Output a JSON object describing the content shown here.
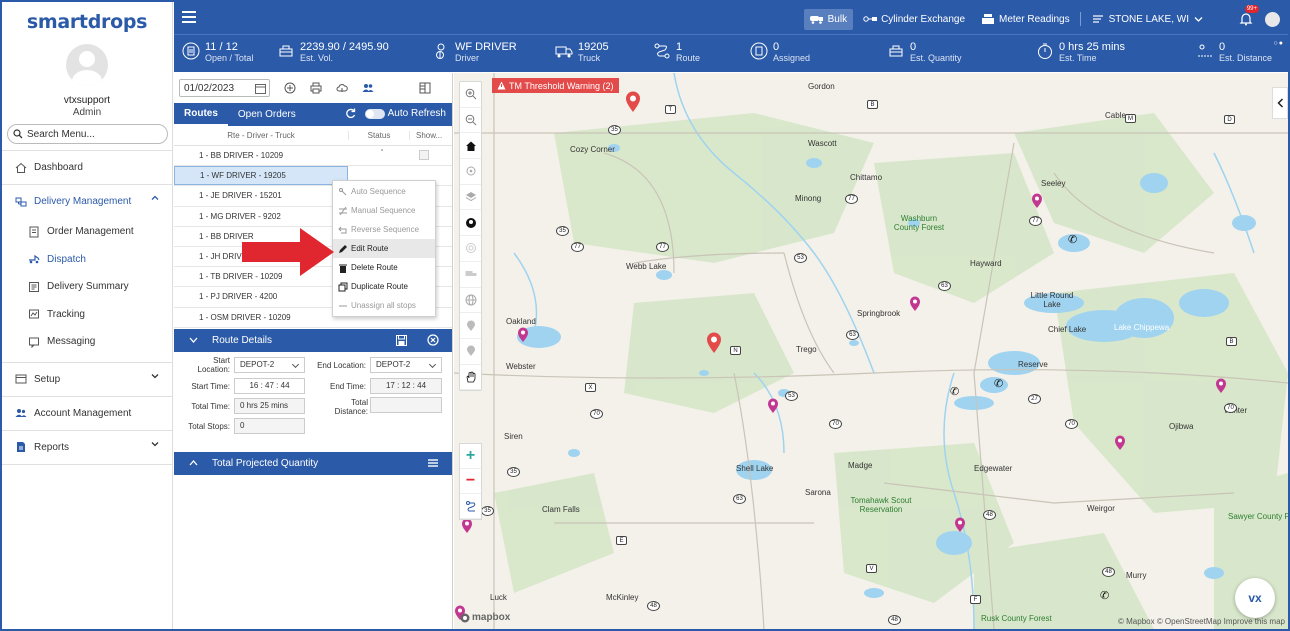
{
  "brand": {
    "logo": "smartdrops"
  },
  "user": {
    "name": "vtxsupport",
    "role": "Admin"
  },
  "search": {
    "placeholder": "Search Menu..."
  },
  "nav": {
    "dashboard": "Dashboard",
    "delivery_management": "Delivery Management",
    "order_management": "Order Management",
    "dispatch": "Dispatch",
    "delivery_summary": "Delivery Summary",
    "tracking": "Tracking",
    "messaging": "Messaging",
    "setup": "Setup",
    "account_management": "Account Management",
    "reports": "Reports"
  },
  "topbar": {
    "bulk": "Bulk",
    "cylinder_exchange": "Cylinder Exchange",
    "meter_readings": "Meter Readings",
    "location": "STONE LAKE, WI",
    "notif_badge": "99+"
  },
  "stats": [
    {
      "value": "11 / 12",
      "label": "Open / Total"
    },
    {
      "value": "2239.90 / 2495.90",
      "label": "Est. Vol."
    },
    {
      "value": "WF DRIVER",
      "label": "Driver"
    },
    {
      "value": "19205",
      "label": "Truck"
    },
    {
      "value": "1",
      "label": "Route"
    },
    {
      "value": "0",
      "label": "Assigned"
    },
    {
      "value": "0",
      "label": "Est. Quantity"
    },
    {
      "value": "0 hrs 25 mins",
      "label": "Est. Time"
    },
    {
      "value": "0",
      "label": "Est. Distance"
    }
  ],
  "dispatch": {
    "date": "01/02/2023",
    "tabs": {
      "routes": "Routes",
      "open_orders": "Open Orders"
    },
    "auto_refresh": "Auto Refresh",
    "columns": {
      "route": "Rte - Driver - Truck",
      "status": "Status",
      "show": "Show..."
    },
    "routes": [
      "1 - BB DRIVER - 10209",
      "1 - WF DRIVER - 19205",
      "1 - JE DRIVER - 15201",
      "1 - MG DRIVER - 9202",
      "1 - BB DRIVER",
      "1 - JH DRIVER",
      "1 - TB DRIVER - 10209",
      "1 - PJ DRIVER - 4200",
      "1 - OSM DRIVER - 10209"
    ],
    "context_menu": {
      "auto_sequence": "Auto Sequence",
      "manual_sequence": "Manual Sequence",
      "reverse_sequence": "Reverse Sequence",
      "edit_route": "Edit Route",
      "delete_route": "Delete Route",
      "duplicate_route": "Duplicate Route",
      "unassign_all": "Unassign all stops"
    }
  },
  "route_details": {
    "title": "Route Details",
    "start_location_label": "Start Location:",
    "start_location": "DEPOT-2",
    "end_location_label": "End Location:",
    "end_location": "DEPOT-2",
    "start_time_label": "Start Time:",
    "start_time": "16 : 47 : 44",
    "end_time_label": "End Time:",
    "end_time": "17 : 12 : 44",
    "total_time_label": "Total Time:",
    "total_time": "0 hrs 25 mins",
    "total_distance_label": "Total Distance:",
    "total_distance": "",
    "total_stops_label": "Total Stops:",
    "total_stops": "0"
  },
  "projected": {
    "title": "Total Projected Quantity"
  },
  "map": {
    "warning": "TM Threshold Warning (2)",
    "labels": {
      "gordon": "Gordon",
      "cable": "Cable",
      "cozy_corner": "Cozy Corner",
      "wascott": "Wascott",
      "chittamo": "Chittamo",
      "minong": "Minong",
      "seeley": "Seeley",
      "washburn_forest": "Washburn County Forest",
      "webb_lake": "Webb Lake",
      "hayward": "Hayward",
      "little_round_lake": "Little Round Lake",
      "springbrook": "Springbrook",
      "oakland": "Oakland",
      "chief_lake": "Chief Lake",
      "lake_chippewa": "Lake Chippewa",
      "trego": "Trego",
      "reserve": "Reserve",
      "webster": "Webster",
      "winter": "Winter",
      "siren": "Siren",
      "ojibwa": "Ojibwa",
      "shell_lake": "Shell Lake",
      "madge": "Madge",
      "edgewater": "Edgewater",
      "sarona": "Sarona",
      "tomahawk_scout": "Tomahawk Scout Reservation",
      "clam_falls": "Clam Falls",
      "weirgor": "Weirgor",
      "sawyer_forest": "Sawyer County F",
      "murry": "Murry",
      "luck": "Luck",
      "mckinley": "McKinley",
      "rusk_forest": "Rusk County Forest"
    },
    "attribution": "© Mapbox © OpenStreetMap  Improve this map",
    "mapbox": "mapbox",
    "fab": "vx"
  }
}
